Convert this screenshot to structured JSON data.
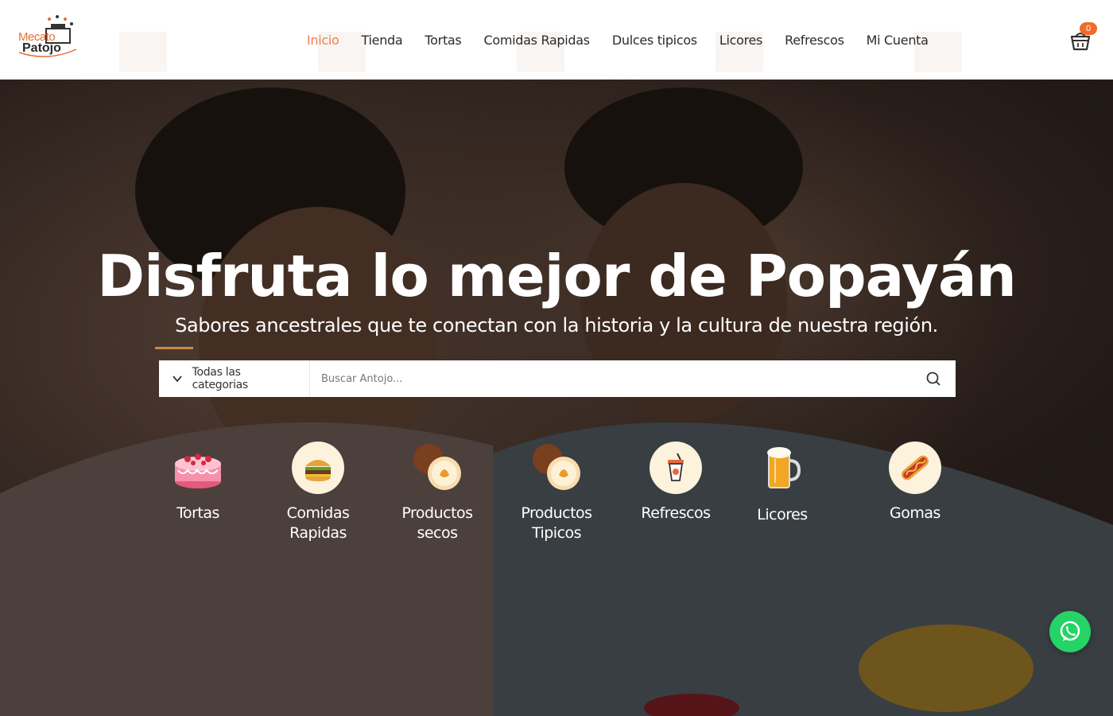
{
  "header": {
    "logo": {
      "line1": "Mecato",
      "line2": "Patojo"
    },
    "nav": [
      {
        "label": "Inicio",
        "active": true
      },
      {
        "label": "Tienda"
      },
      {
        "label": "Tortas"
      },
      {
        "label": "Comidas Rapidas"
      },
      {
        "label": "Dulces tipicos"
      },
      {
        "label": "Licores"
      },
      {
        "label": "Refrescos"
      },
      {
        "label": "Mi Cuenta"
      }
    ],
    "cart": {
      "count": "0",
      "icon": "basket-icon"
    }
  },
  "hero": {
    "title": "Disfruta lo mejor de Popayán",
    "subtitle": "Sabores ancestrales que te conectan con la historia y la cultura de nuestra región.",
    "accent_color": "#c98b4a"
  },
  "search": {
    "category_label": "Todas las categorias",
    "placeholder": "Buscar Antojo..."
  },
  "categories": [
    {
      "label": "Tortas",
      "icon": "cake-icon"
    },
    {
      "label": "Comidas Rapidas",
      "icon": "burger-icon"
    },
    {
      "label": "Productos secos",
      "icon": "dried-fruit-icon"
    },
    {
      "label": "Productos Tipicos",
      "icon": "typical-product-icon"
    },
    {
      "label": "Refrescos",
      "icon": "soda-cup-icon"
    },
    {
      "label": "Licores",
      "icon": "beer-mug-icon"
    },
    {
      "label": "Gomas",
      "icon": "hotdog-icon"
    }
  ],
  "colors": {
    "active_nav": "#ef7d45",
    "cart_badge": "#f06b2a",
    "whatsapp": "#25d366"
  }
}
